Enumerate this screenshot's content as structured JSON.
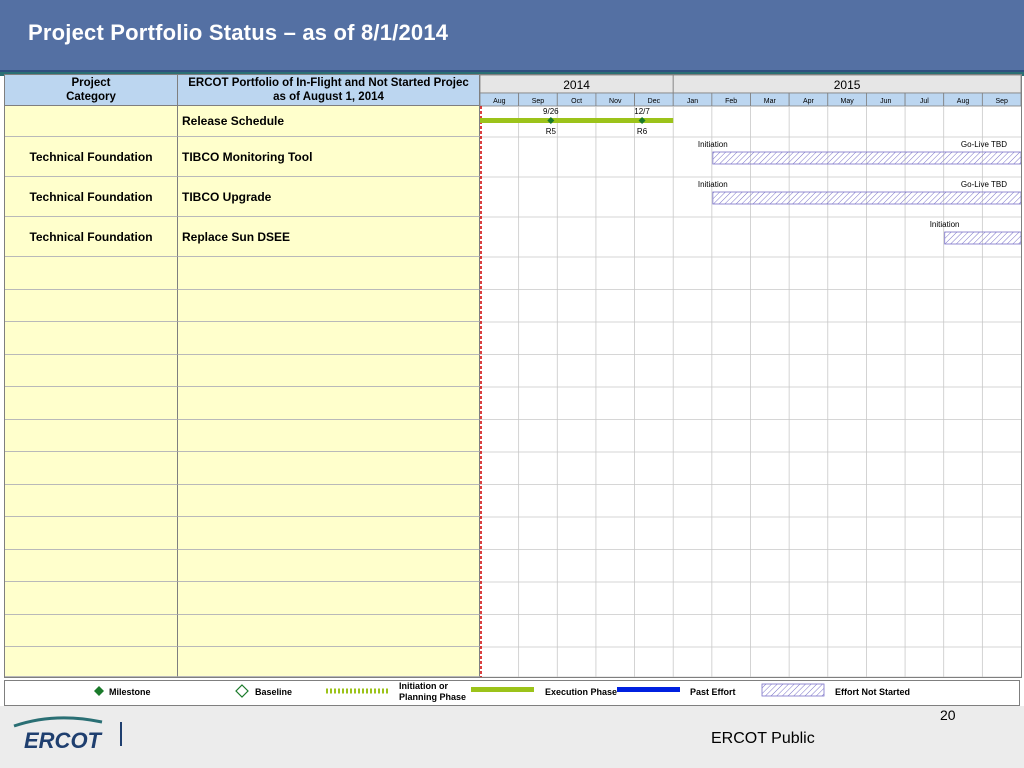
{
  "title": "Project Portfolio Status – as of 8/1/2014",
  "table": {
    "category_header": [
      "Project",
      "Category"
    ],
    "name_header": [
      "ERCOT Portfolio of In-Flight and Not Started Projec",
      "as of August 1, 2014"
    ],
    "rows": [
      {
        "category": "",
        "name": "Release Schedule"
      },
      {
        "category": "Technical Foundation",
        "name": "TIBCO Monitoring Tool"
      },
      {
        "category": "Technical Foundation",
        "name": "TIBCO Upgrade"
      },
      {
        "category": "Technical Foundation",
        "name": "Replace Sun DSEE"
      }
    ]
  },
  "chart_data": {
    "type": "gantt",
    "years": [
      {
        "label": "2014",
        "months": 5
      },
      {
        "label": "2015",
        "months": 9
      }
    ],
    "months": [
      "Aug",
      "Sep",
      "Oct",
      "Nov",
      "Dec",
      "Jan",
      "Feb",
      "Mar",
      "Apr",
      "May",
      "Jun",
      "Jul",
      "Aug",
      "Sep"
    ],
    "start_month": "2014-08",
    "status_date": "2014-08-01",
    "tasks": [
      {
        "row": 0,
        "bars": [
          {
            "start": "2014-08-01",
            "end": "2014-12-31",
            "phase": "execution"
          }
        ],
        "milestones": [
          {
            "date": "2014-09-26",
            "label_top": "9/26",
            "label_bottom": "R5"
          },
          {
            "date": "2014-12-07",
            "label_top": "12/7",
            "label_bottom": "R6"
          }
        ]
      },
      {
        "row": 1,
        "bars": [
          {
            "start": "2015-02-01",
            "end": "2015-09-30",
            "phase": "not_started"
          }
        ],
        "labels": [
          {
            "text": "Initiation",
            "at": "start"
          },
          {
            "text": "Go-Live TBD",
            "at": "end"
          }
        ]
      },
      {
        "row": 2,
        "bars": [
          {
            "start": "2015-02-01",
            "end": "2015-09-30",
            "phase": "not_started"
          }
        ],
        "labels": [
          {
            "text": "Initiation",
            "at": "start"
          },
          {
            "text": "Go-Live TBD",
            "at": "end"
          }
        ]
      },
      {
        "row": 3,
        "bars": [
          {
            "start": "2015-08-01",
            "end": "2015-09-30",
            "phase": "not_started"
          }
        ],
        "labels": [
          {
            "text": "Initiation",
            "at": "start"
          }
        ]
      }
    ]
  },
  "legend": {
    "milestone": "Milestone",
    "baseline": "Baseline",
    "initiation_l1": "Initiation or",
    "initiation_l2": "Planning Phase",
    "execution": "Execution Phase",
    "past": "Past Effort",
    "not_started": "Effort Not Started"
  },
  "colors": {
    "header": "#5470a3",
    "column_header": "#bcd6f0",
    "category_fill": "#ffffcc",
    "execution": "#9cc31a",
    "past": "#0020e0",
    "not_started": "#7a72c8",
    "milestone": "#1a7a2a",
    "status_line": "#d00000"
  },
  "footer": {
    "page": "20",
    "public": "ERCOT Public",
    "logo": "ERCOT"
  }
}
